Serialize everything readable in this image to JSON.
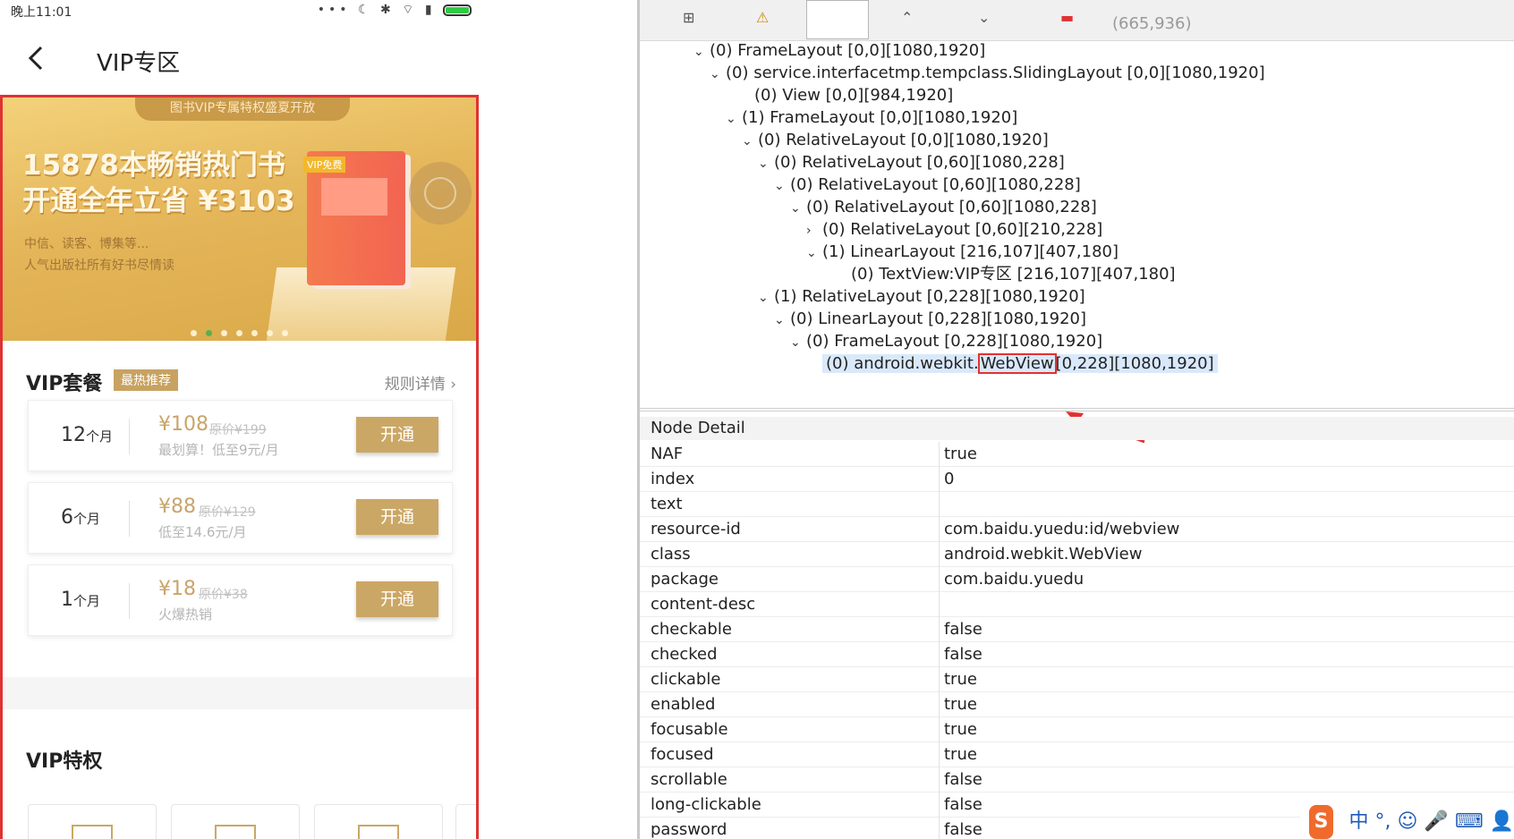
{
  "phone": {
    "status_time": "晚上11:01",
    "title": "VIP专区",
    "banner": {
      "ribbon": "图书VIP专属特权盛夏开放",
      "headline1": "15878本畅销热门书",
      "headline2": "开通全年立省 ¥3103",
      "sub1": "中信、读客、博集等...",
      "sub2": "人气出版社所有好书尽情读",
      "book_tag": "VIP免费",
      "dot_count": 7,
      "active_dot": 1
    },
    "plans_section": {
      "title": "VIP套餐",
      "badge": "最热推荐",
      "rules": "规则详情"
    },
    "plans": [
      {
        "months_num": "12",
        "months_unit": "个月",
        "price": "¥108",
        "orig": "原价¥199",
        "note": "最划算！低至9元/月",
        "button": "开通"
      },
      {
        "months_num": "6",
        "months_unit": "个月",
        "price": "¥88",
        "orig": "原价¥129",
        "note": "低至14.6元/月",
        "button": "开通"
      },
      {
        "months_num": "1",
        "months_unit": "个月",
        "price": "¥18",
        "orig": "原价¥38",
        "note": "火爆热销",
        "button": "开通"
      }
    ],
    "privileges_title": "VIP特权"
  },
  "inspector": {
    "coords": "(665,936)",
    "tree": [
      {
        "expanded": true,
        "label": "(0) FrameLayout [0,0][1080,1920]"
      },
      {
        "expanded": true,
        "label": "(0) service.interfacetmp.tempclass.SlidingLayout [0,0][1080,1920]"
      },
      {
        "expanded": null,
        "label": "(0) View [0,0][984,1920]"
      },
      {
        "expanded": true,
        "label": "(1) FrameLayout [0,0][1080,1920]"
      },
      {
        "expanded": true,
        "label": "(0) RelativeLayout [0,0][1080,1920]"
      },
      {
        "expanded": true,
        "label": "(0) RelativeLayout [0,60][1080,228]"
      },
      {
        "expanded": true,
        "label": "(0) RelativeLayout [0,60][1080,228]"
      },
      {
        "expanded": true,
        "label": "(0) RelativeLayout [0,60][1080,228]"
      },
      {
        "expanded": false,
        "label": "(0) RelativeLayout [0,60][210,228]"
      },
      {
        "expanded": true,
        "label": "(1) LinearLayout [216,107][407,180]"
      },
      {
        "expanded": null,
        "label": "(0) TextView:VIP专区 [216,107][407,180]"
      },
      {
        "expanded": true,
        "label": "(1) RelativeLayout [0,228][1080,1920]"
      },
      {
        "expanded": true,
        "label": "(0) LinearLayout [0,228][1080,1920]"
      },
      {
        "expanded": true,
        "label": "(0) FrameLayout [0,228][1080,1920]"
      }
    ],
    "selected_node": {
      "prefix": "(0) android.webkit.",
      "highlight": "WebView",
      "suffix": "[0,228][1080,1920]"
    },
    "detail_title": "Node Detail",
    "details": [
      {
        "key": "NAF",
        "value": "true"
      },
      {
        "key": "index",
        "value": "0"
      },
      {
        "key": "text",
        "value": ""
      },
      {
        "key": "resource-id",
        "value": "com.baidu.yuedu:id/webview"
      },
      {
        "key": "class",
        "value": "android.webkit.WebView"
      },
      {
        "key": "package",
        "value": "com.baidu.yuedu"
      },
      {
        "key": "content-desc",
        "value": ""
      },
      {
        "key": "checkable",
        "value": "false"
      },
      {
        "key": "checked",
        "value": "false"
      },
      {
        "key": "clickable",
        "value": "true"
      },
      {
        "key": "enabled",
        "value": "true"
      },
      {
        "key": "focusable",
        "value": "true"
      },
      {
        "key": "focused",
        "value": "true"
      },
      {
        "key": "scrollable",
        "value": "false"
      },
      {
        "key": "long-clickable",
        "value": "false"
      },
      {
        "key": "password",
        "value": "false"
      }
    ],
    "ime_label": "中"
  },
  "colors": {
    "accent_gold": "#cba766",
    "highlight_red": "#e03232",
    "selection_blue": "#d9e9fb"
  }
}
